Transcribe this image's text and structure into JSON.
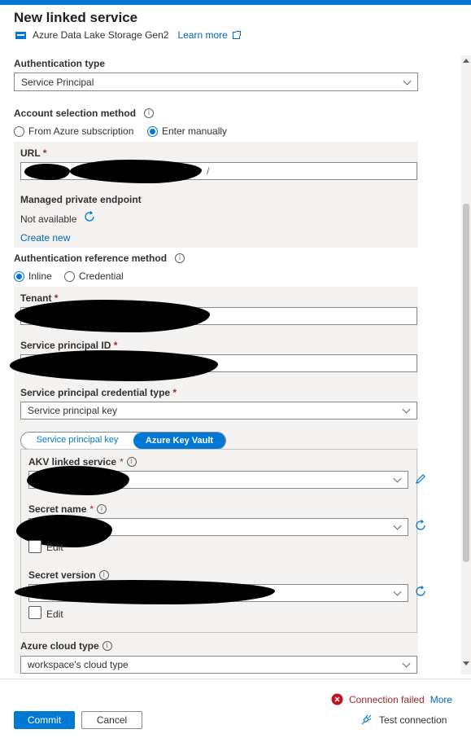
{
  "panel": {
    "title": "New linked service",
    "service_name": "Azure Data Lake Storage Gen2",
    "learn_more": "Learn more"
  },
  "auth_type": {
    "label": "Authentication type",
    "value": "Service Principal"
  },
  "account_selection": {
    "label": "Account selection method",
    "options": [
      "From Azure subscription",
      "Enter manually"
    ],
    "selected": "Enter manually"
  },
  "url": {
    "label": "URL",
    "required": "*",
    "value_suffix": "/"
  },
  "managed_private_endpoint": {
    "label": "Managed private endpoint",
    "status": "Not available",
    "create_new": "Create new"
  },
  "auth_reference": {
    "label": "Authentication reference method",
    "options": [
      "Inline",
      "Credential"
    ],
    "selected": "Inline"
  },
  "tenant": {
    "label": "Tenant",
    "required": "*"
  },
  "service_principal_id": {
    "label": "Service principal ID",
    "required": "*"
  },
  "credential_type": {
    "label": "Service principal credential type",
    "required": "*",
    "value": "Service principal key"
  },
  "toggle": {
    "options": [
      "Service principal key",
      "Azure Key Vault"
    ],
    "selected": "Azure Key Vault"
  },
  "akv": {
    "label": "AKV linked service",
    "required": "*"
  },
  "secret_name": {
    "label": "Secret name",
    "required": "*",
    "edit": "Edit"
  },
  "secret_version": {
    "label": "Secret version",
    "edit": "Edit"
  },
  "cloud_type": {
    "label": "Azure cloud type",
    "value": "workspace's cloud type"
  },
  "footer": {
    "status": "Connection failed",
    "more": "More",
    "commit": "Commit",
    "cancel": "Cancel",
    "test_connection": "Test connection"
  },
  "colors": {
    "accent": "#0078d4",
    "error": "#a4262c",
    "link": "#0067b8"
  }
}
